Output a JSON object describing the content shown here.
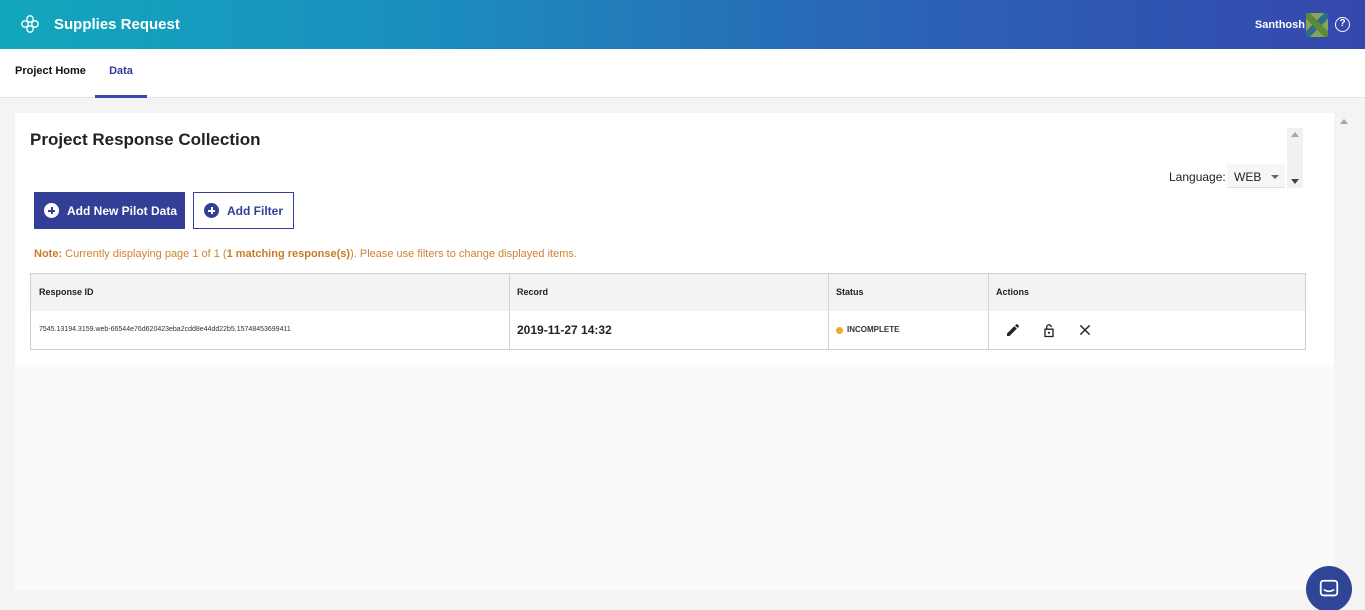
{
  "header": {
    "app_title": "Supplies Request",
    "user_name": "Santhosh",
    "help_glyph": "?",
    "icons": [
      "flower-logo-icon",
      "avatar",
      "help-icon"
    ]
  },
  "tabs": [
    {
      "label": "Project Home",
      "active": false
    },
    {
      "label": "Data",
      "active": true
    }
  ],
  "main": {
    "title": "Project Response Collection",
    "language_label": "Language:",
    "language_value": "WEB",
    "add_pilot_label": "Add New Pilot Data",
    "add_filter_label": "Add Filter",
    "note": {
      "prefix": "Note:",
      "text1": " Currently displaying page 1 of 1 (",
      "bold": "1 matching response(s)",
      "text2": "). Please use filters to change displayed items."
    },
    "table": {
      "headers": [
        "Response ID",
        "Record",
        "Status",
        "Actions"
      ],
      "rows": [
        {
          "response_id": "7545.13194.3159.web-66544e76d620423eba2cdd8e44dd22b5.15748453699411",
          "record": "2019-11-27 14:32",
          "status": "INCOMPLETE",
          "status_color": "#f1a91d",
          "actions": [
            "edit-icon",
            "lock-icon",
            "delete-icon"
          ]
        }
      ]
    }
  },
  "colors": {
    "accent": "#333f96",
    "header_gradient_start": "#11a7bd",
    "header_gradient_end": "#3548ad",
    "note": "#d08232"
  }
}
